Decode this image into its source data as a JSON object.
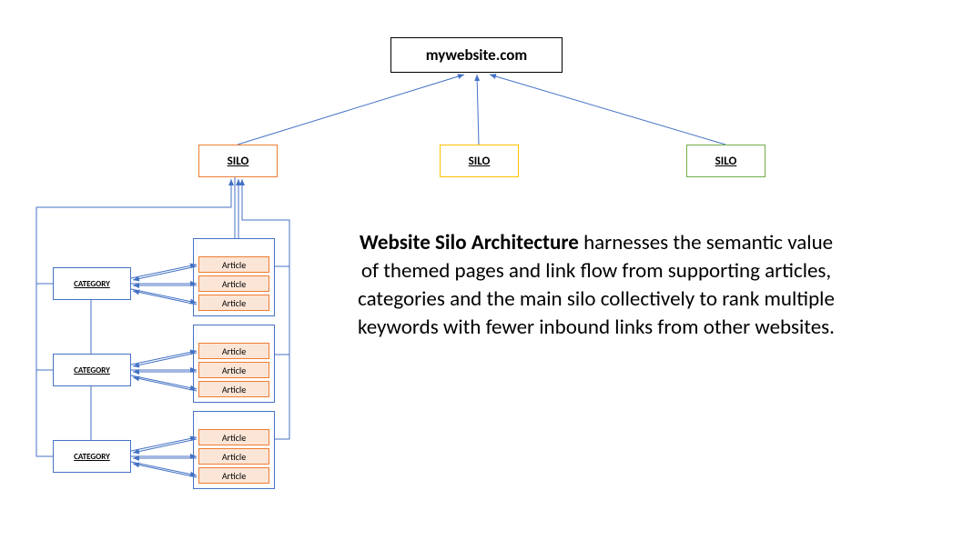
{
  "root": {
    "label": "mywebsite.com"
  },
  "silos": [
    {
      "label": "SILO"
    },
    {
      "label": "SILO"
    },
    {
      "label": "SILO"
    }
  ],
  "categories": [
    {
      "label": "CATEGORY",
      "articles": [
        "Article",
        "Article",
        "Article"
      ]
    },
    {
      "label": "CATEGORY",
      "articles": [
        "Article",
        "Article",
        "Article"
      ]
    },
    {
      "label": "CATEGORY",
      "articles": [
        "Article",
        "Article",
        "Article"
      ]
    }
  ],
  "description": {
    "bold": "Website Silo Architecture",
    "rest": " harnesses the semantic value of themed pages and link flow from supporting articles, categories and the main silo collectively to rank multiple keywords with fewer inbound links from other websites."
  }
}
